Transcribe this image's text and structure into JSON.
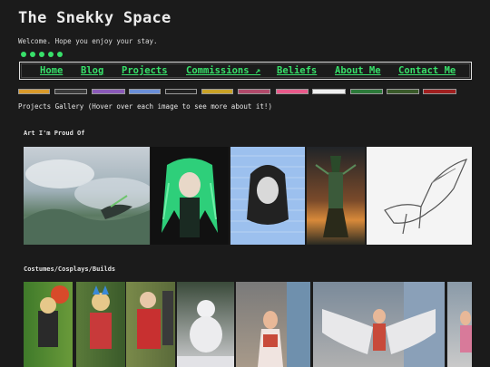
{
  "site": {
    "title": "The Snekky Space",
    "subtitle": "Welcome. Hope you enjoy your stay."
  },
  "social_icons": [
    "youtube-icon",
    "deviantart-icon",
    "twitter-icon",
    "discord-icon",
    "tumblr-icon"
  ],
  "nav": {
    "items": [
      {
        "label": "Home"
      },
      {
        "label": "Blog"
      },
      {
        "label": "Projects"
      },
      {
        "label": "Commissions ↗"
      },
      {
        "label": "Beliefs"
      },
      {
        "label": "About Me"
      },
      {
        "label": "Contact Me"
      }
    ]
  },
  "badges": [
    {
      "name": "badge-1",
      "color": "#d99a2b"
    },
    {
      "name": "badge-2",
      "color": "#3a3a3a"
    },
    {
      "name": "badge-3",
      "color": "#8a5ab8"
    },
    {
      "name": "badge-4",
      "color": "#6a8fd8"
    },
    {
      "name": "badge-5",
      "color": "#222222"
    },
    {
      "name": "badge-6",
      "color": "#c9a227"
    },
    {
      "name": "badge-7",
      "color": "#d8d8d8"
    },
    {
      "name": "badge-8",
      "color": "#b04a6a"
    },
    {
      "name": "badge-9",
      "color": "#e85a8a"
    },
    {
      "name": "badge-10",
      "color": "#efefef"
    },
    {
      "name": "badge-11",
      "color": "#2c7a3a"
    },
    {
      "name": "badge-12",
      "color": "#3a5a2a"
    },
    {
      "name": "badge-13",
      "color": "#a02020"
    }
  ],
  "gallery": {
    "label": "Projects Gallery (Hover over each image to see more about it!)",
    "sections": [
      {
        "title": "Art I'm Proud Of",
        "images": [
          {
            "name": "art-landscape-dragon"
          },
          {
            "name": "art-green-hair"
          },
          {
            "name": "art-sketch-portrait"
          },
          {
            "name": "art-sunset-character"
          },
          {
            "name": "art-dragon-lineart"
          }
        ]
      },
      {
        "title": "Costumes/Cosplays/Builds",
        "images": [
          {
            "name": "cosplay-1"
          },
          {
            "name": "cosplay-2"
          },
          {
            "name": "cosplay-3"
          },
          {
            "name": "snow-sculpture"
          },
          {
            "name": "costume-wings-1"
          },
          {
            "name": "costume-wings-2"
          },
          {
            "name": "costume-edge"
          }
        ]
      }
    ]
  }
}
